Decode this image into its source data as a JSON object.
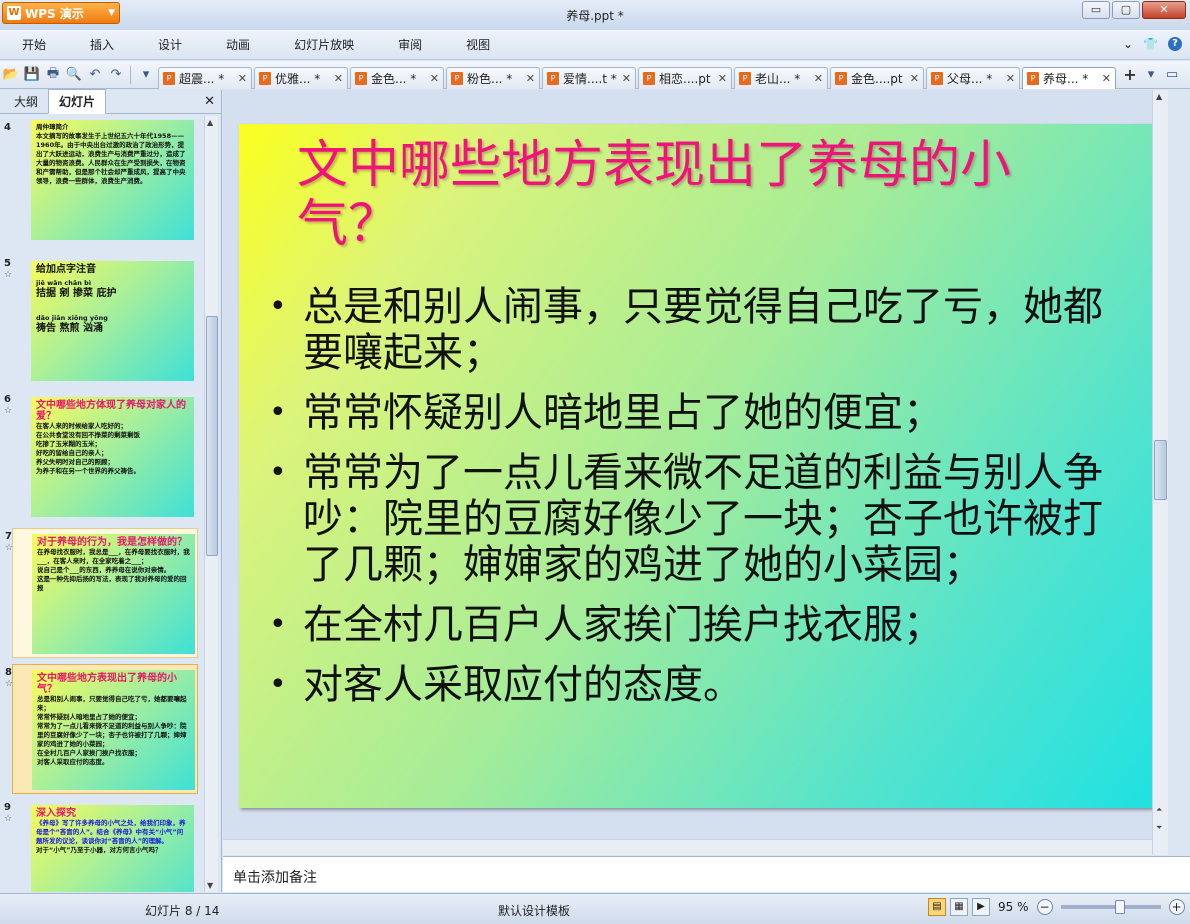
{
  "app": {
    "name": "WPS 演示",
    "title": "养母.ppt *"
  },
  "window_controls": {
    "minimize": "▭",
    "maximize": "▢",
    "close": "✕"
  },
  "menu": [
    "开始",
    "插入",
    "设计",
    "动画",
    "幻灯片放映",
    "审阅",
    "视图"
  ],
  "toolbar_icons": [
    "open-folder-icon",
    "save-icon",
    "print-icon",
    "print-preview-icon",
    "undo-icon",
    "redo-icon"
  ],
  "tabs": [
    {
      "label": "超震... *",
      "active": false
    },
    {
      "label": "优雅... *",
      "active": false
    },
    {
      "label": "金色... *",
      "active": false
    },
    {
      "label": "粉色... *",
      "active": false
    },
    {
      "label": "爱情....t *",
      "active": false
    },
    {
      "label": "相恋....pt",
      "active": false
    },
    {
      "label": "老山... *",
      "active": false
    },
    {
      "label": "金色....pt",
      "active": false
    },
    {
      "label": "父母... *",
      "active": false
    },
    {
      "label": "养母... *",
      "active": true
    }
  ],
  "left_panel": {
    "tabs": [
      "大纲",
      "幻灯片"
    ],
    "active_tab": "幻灯片",
    "thumbnails": [
      {
        "num": "4",
        "title": "",
        "lines": [
          "周仲璋简介",
          "本文摘写的故事发生于上世纪五六十年代1958——1960年。由于中央出台过激的政治了政治形势，提出了大跃进运动，浪费生产与消费严重过分，造成了大量的物资浪费。人民群众在生产受到损失，在物资和产需帮助，但是那个社会却严重成风，提高了中央领导，浪费一些群体，浪费生产消费。"
        ]
      },
      {
        "num": "5",
        "title": "给加点字注音",
        "lines": [
          "jiē  wǎn  chān  bì",
          "拮据  剜  掺菜  庇护",
          "dǎo  jiān  xiōng yǒng",
          "祷告  熬煎  汹涌"
        ]
      },
      {
        "num": "6",
        "title": "文中哪些地方体现了养母对家人的爱？",
        "lines": [
          "在客人来的时候给家人吃好的；",
          "在公共食堂没有回不挣菜的剩菜剩饭",
          "吃掺了玉米糊的玉米；",
          "好吃的留给自己的亲人；",
          "养父失明时对自己的照顾；",
          "为养子和在另一个世界的养父祷告。"
        ]
      },
      {
        "num": "7",
        "title": "对于养母的行为，我是怎样做的？",
        "lines": [
          "在养母找衣服时，我总是___，在养母要找衣服时，我___，在客人来时，在全家吃着之___；",
          "说自己是个___的东西，养养母在说你对亲情。",
          "这是一种先抑后扬的写法，表现了我对养母的爱的回报"
        ]
      },
      {
        "num": "8",
        "title": "文中哪些地方表现出了养母的小气？",
        "lines": [
          "总是和别人闹事，只要觉得自己吃了亏，她都要嚷起来；",
          "常常怀疑别人暗地里占了她的便宜；",
          "常常为了一点儿看来微不足道的利益与别人争吵：院里的豆腐好像少了一块；杏子也许被打了几颗；婶婶家的鸡进了她的小菜园；",
          "在全村几百户人家挨门挨户找衣服；",
          "对客人采取应付的态度。"
        ]
      },
      {
        "num": "9",
        "title": "深入探究",
        "lines": [
          "《养母》写了许多养母的小气之处，给我们印象，养母是个“吝啬的人”。结合《养母》中有关“小气”问题所发的议论，谈谈你对“吝啬的人”的理解。",
          "对于“小气”乃至于小器，对方何言小气吗？"
        ]
      }
    ]
  },
  "slide": {
    "title": "文中哪些地方表现出了养母的小气？",
    "bullets": [
      "总是和别人闹事，只要觉得自己吃了亏，她都要嚷起来；",
      "常常怀疑别人暗地里占了她的便宜；",
      "常常为了一点儿看来微不足道的利益与别人争吵：院里的豆腐好像少了一块；杏子也许被打了几颗；婶婶家的鸡进了她的小菜园；",
      "在全村几百户人家挨门挨户找衣服；",
      "对客人采取应付的态度。"
    ],
    "bullet_glyph": "•"
  },
  "notes": {
    "placeholder": "单击添加备注"
  },
  "status": {
    "slide_counter": "幻灯片 8 / 14",
    "template": "默认设计模板",
    "zoom": "95 %"
  },
  "colors": {
    "accent": "#e86a1d",
    "title": "#f0137a"
  }
}
